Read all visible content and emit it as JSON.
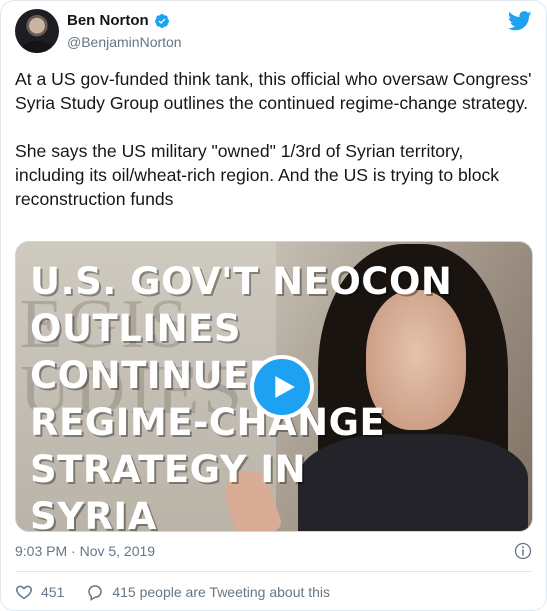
{
  "author": {
    "name": "Ben Norton",
    "handle": "@BenjaminNorton"
  },
  "tweet": {
    "text": "At a US gov-funded think tank, this official who oversaw Congress' Syria Study Group outlines the continued regime-change strategy.\n\nShe says the US military \"owned\" 1/3rd of Syrian territory, including its oil/wheat-rich region. And the US is trying to block reconstruction funds",
    "timestamp": "9:03 PM · Nov 5, 2019"
  },
  "media": {
    "caption": "U.S. GOV'T NEOCON\nOUTLINES\nCONTINUED\nREGIME-CHANGE\nSTRATEGY IN\nSYRIA",
    "bg_letters": "EGIS\nUDIES"
  },
  "actions": {
    "likes": "451",
    "tweeting": "415 people are Tweeting about this"
  },
  "colors": {
    "accent": "#1da1f2",
    "text": "#14171a",
    "muted": "#657786",
    "like_icon": "#657786"
  },
  "icons": {
    "verified": "verified-badge-icon",
    "brand": "twitter-bird-icon",
    "play": "play-icon",
    "info": "info-icon",
    "like": "heart-icon",
    "reply": "speech-bubble-icon"
  }
}
